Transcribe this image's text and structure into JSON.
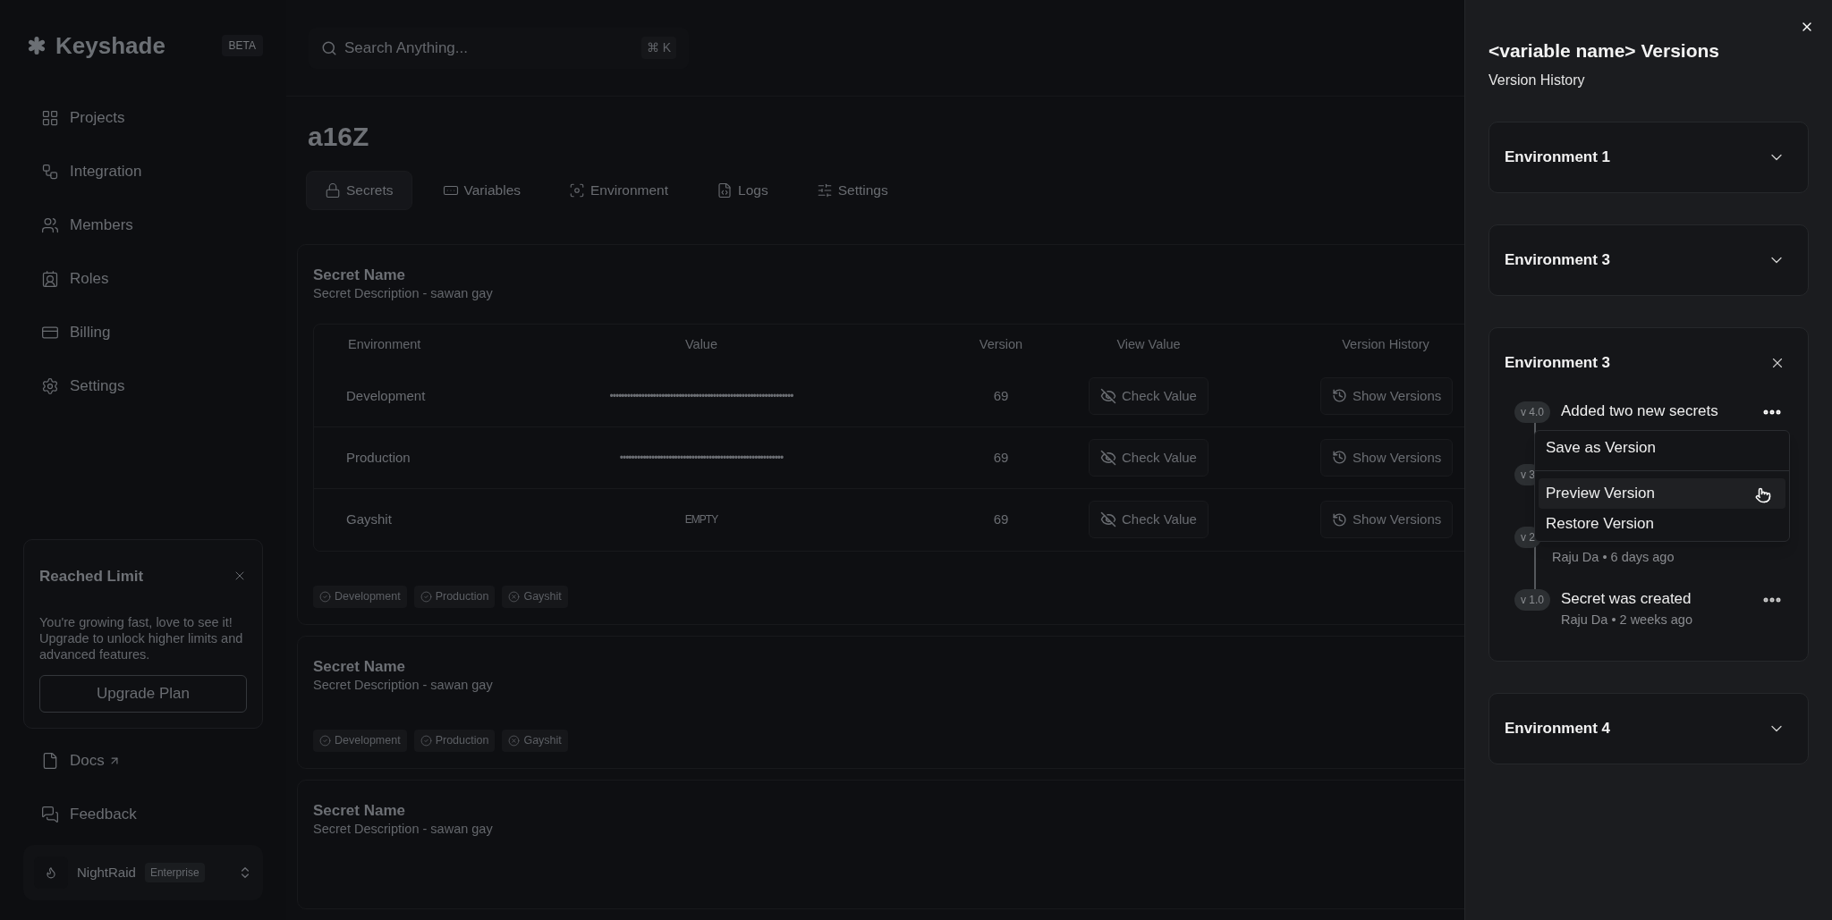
{
  "sidebar": {
    "logo": "Keyshade",
    "badge": "BETA",
    "nav": [
      {
        "label": "Projects",
        "kind": "grid"
      },
      {
        "label": "Integration",
        "kind": "workflow"
      },
      {
        "label": "Members",
        "kind": "users"
      },
      {
        "label": "Roles",
        "kind": "role"
      },
      {
        "label": "Billing",
        "kind": "billing"
      },
      {
        "label": "Settings",
        "kind": "settings"
      }
    ],
    "limit_card": {
      "title": "Reached Limit",
      "text": "You're growing fast, love to see it! Upgrade to unlock higher limits and advanced features.",
      "button": "Upgrade Plan"
    },
    "links": [
      {
        "label": "Docs",
        "kind": "docs",
        "external": true
      },
      {
        "label": "Feedback",
        "kind": "feedback",
        "external": false
      }
    ],
    "workspace": {
      "name": "NightRaid",
      "plan": "Enterprise"
    }
  },
  "search": {
    "placeholder": "Search Anything...",
    "shortcut": "⌘ K"
  },
  "project": {
    "title": "a16Z"
  },
  "tabs": [
    {
      "label": "Secrets",
      "kind": "lock",
      "selected": true
    },
    {
      "label": "Variables",
      "kind": "variables",
      "selected": false
    },
    {
      "label": "Environment",
      "kind": "environment",
      "selected": false
    },
    {
      "label": "Logs",
      "kind": "logs",
      "selected": false
    },
    {
      "label": "Settings",
      "kind": "sliders",
      "selected": false
    }
  ],
  "secrets": [
    {
      "name": "Secret Name",
      "description": "Secret Description - sawan gay",
      "table": {
        "columns": [
          "Environment",
          "Value",
          "Version",
          "View Value",
          "Version History"
        ],
        "rows": [
          {
            "environment": "Development",
            "value": "••••••••••••••••••••••••••••••••••••••••••••••••••••••••••••••••",
            "version": "69",
            "view": "Check Value",
            "history": "Show Versions"
          },
          {
            "environment": "Production",
            "value": "•••••••••••••••••••••••••••••••••••••••••••••••••••••••••",
            "version": "69",
            "view": "Check Value",
            "history": "Show Versions"
          },
          {
            "environment": "Gayshit",
            "value": "EMPTY",
            "version": "69",
            "view": "Check Value",
            "history": "Show Versions"
          }
        ]
      },
      "tags": [
        {
          "label": "Development",
          "kind": "ok"
        },
        {
          "label": "Production",
          "kind": "ok"
        },
        {
          "label": "Gayshit",
          "kind": "missing"
        }
      ]
    },
    {
      "name": "Secret Name",
      "description": "Secret Description - sawan gay",
      "tags": [
        {
          "label": "Development",
          "kind": "ok"
        },
        {
          "label": "Production",
          "kind": "ok"
        },
        {
          "label": "Gayshit",
          "kind": "missing"
        }
      ]
    },
    {
      "name": "Secret Name",
      "description": "Secret Description - sawan gay"
    }
  ],
  "sheet": {
    "title": "<variable name> Versions",
    "subtitle": "Version History",
    "environments": [
      {
        "name": "Environment 1",
        "expanded": false
      },
      {
        "name": "Environment 3",
        "expanded": false
      },
      {
        "name": "Environment 3",
        "expanded": true,
        "versions": [
          {
            "badge": "v 4.0",
            "title": "Added two new secrets",
            "menu_open": true
          },
          {
            "badge": "v 3"
          },
          {
            "badge": "v 2",
            "meta": "Raju Da • 6 days ago"
          },
          {
            "badge": "v 1.0",
            "title": "Secret was created",
            "meta": "Raju Da • 2 weeks ago",
            "menu_open": false
          }
        ],
        "menu": [
          {
            "label": "Save as Version",
            "selected": false
          },
          {
            "label": "Preview Version",
            "selected": true
          },
          {
            "label": "Restore Version",
            "selected": false
          }
        ]
      },
      {
        "name": "Environment 4",
        "expanded": false
      }
    ]
  }
}
